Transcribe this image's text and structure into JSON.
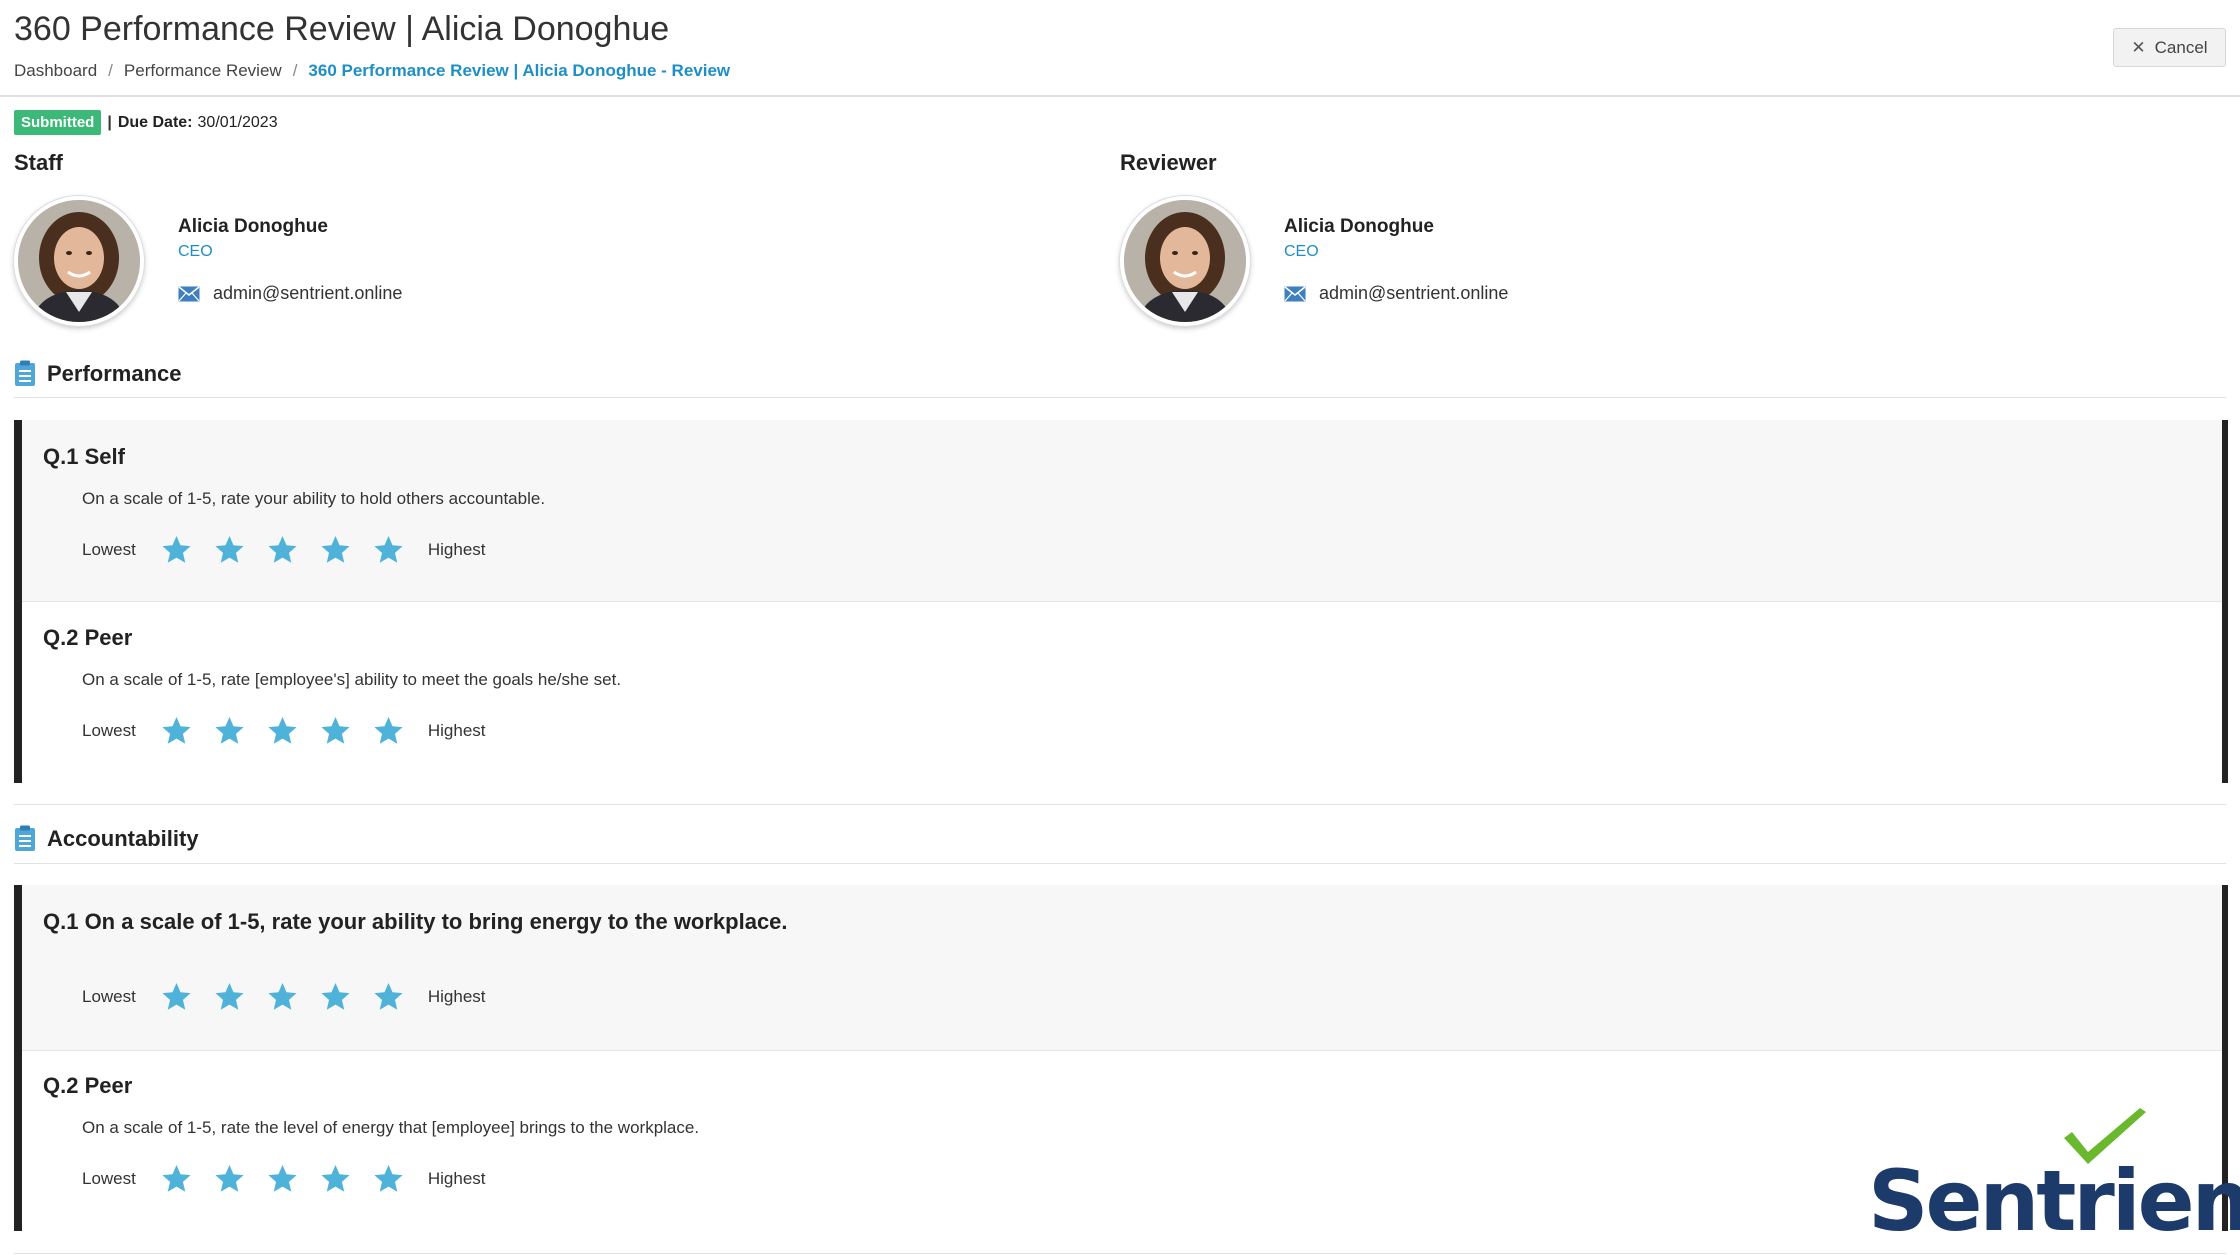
{
  "header": {
    "title": "360 Performance Review | Alicia Donoghue",
    "breadcrumb": [
      "Dashboard",
      "Performance Review",
      "360 Performance Review | Alicia Donoghue - Review"
    ],
    "cancel_label": "Cancel"
  },
  "status": {
    "badge": "Submitted",
    "badge_color": "#3cb878",
    "separator": "|",
    "due_label": "Due Date:",
    "due_value": "30/01/2023"
  },
  "staff": {
    "heading": "Staff",
    "name": "Alicia Donoghue",
    "role": "CEO",
    "email": "admin@sentrient.online"
  },
  "reviewer": {
    "heading": "Reviewer",
    "name": "Alicia Donoghue",
    "role": "CEO",
    "email": "admin@sentrient.online"
  },
  "sections": [
    {
      "title": "Performance",
      "questions": [
        {
          "title": "Q.1 Self",
          "text": "On a scale of 1-5, rate your ability to hold others accountable.",
          "low": "Lowest",
          "high": "Highest"
        },
        {
          "title": "Q.2 Peer",
          "text": "On a scale of 1-5, rate [employee's] ability to meet the goals he/she set.",
          "low": "Lowest",
          "high": "Highest"
        }
      ]
    },
    {
      "title": "Accountability",
      "questions": [
        {
          "title": "Q.1 On a scale of 1-5, rate your ability to bring energy to the workplace.",
          "text": "",
          "low": "Lowest",
          "high": "Highest"
        },
        {
          "title": "Q.2 Peer",
          "text": "On a scale of 1-5, rate the level of energy that [employee] brings to the workplace.",
          "low": "Lowest",
          "high": "Highest"
        }
      ]
    }
  ],
  "star_color": "#4fb3d9",
  "accent_color": "#1e8fc6",
  "logo": {
    "text": "Sentrient",
    "color": "#1d3b6a",
    "check_color": "#6ab82e"
  }
}
